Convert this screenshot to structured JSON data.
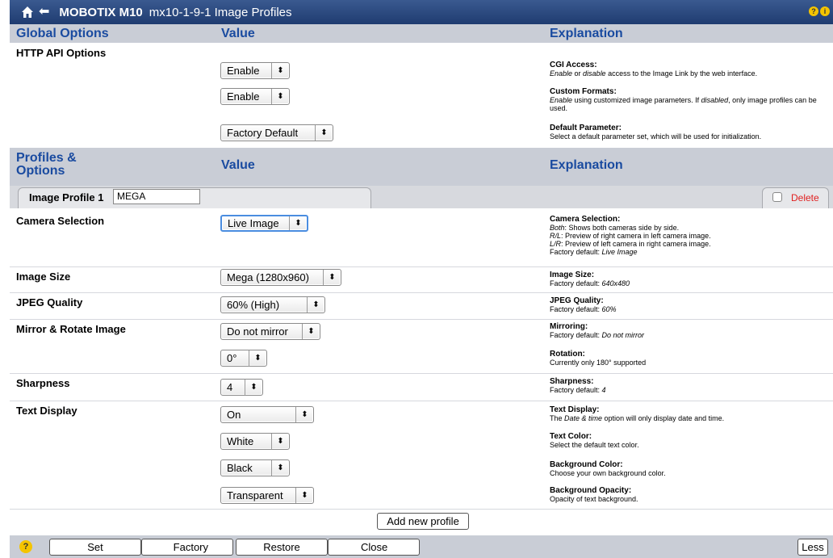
{
  "header": {
    "brand": "MOBOTIX M10",
    "subtitle": "mx10-1-9-1 Image Profiles"
  },
  "global": {
    "heading": "Global Options",
    "value_heading": "Value",
    "explanation_heading": "Explanation",
    "rows": [
      {
        "label": "HTTP API Options"
      }
    ],
    "selects": [
      "Enable",
      "Enable",
      "Factory Default"
    ],
    "explanations": [
      {
        "title": "CGI Access",
        "text_a": "Enable",
        "text_b": " or ",
        "text_c": "disable",
        "text_d": " access to the Image Link by the web interface."
      },
      {
        "title": "Custom Formats",
        "text_a": "Enable",
        "text_b": " using customized image parameters. If ",
        "text_c": "disabled",
        "text_d": ", only image profiles can be used."
      },
      {
        "title": "Default Parameter",
        "text_a": "",
        "text_b": "Select a default parameter set, which will be used for initialization.",
        "text_c": "",
        "text_d": ""
      }
    ]
  },
  "profiles": {
    "heading": "Profiles & Options",
    "value_heading": "Value",
    "explanation_heading": "Explanation",
    "tab_label": "Image Profile 1",
    "profile_name": "MEGA",
    "delete_label": "Delete",
    "rows": {
      "camera_selection": "Camera Selection",
      "image_size": "Image Size",
      "jpeg_quality": "JPEG Quality",
      "mirror_rotate": "Mirror & Rotate Image",
      "sharpness": "Sharpness",
      "text_display": "Text Display"
    },
    "selects": {
      "camera_selection": "Live Image",
      "image_size": "Mega (1280x960)",
      "jpeg_quality": "60% (High)",
      "mirror": "Do not mirror",
      "rotation": "0°",
      "sharpness": "4",
      "text_display": "On",
      "text_color": "White",
      "bg_color": "Black",
      "bg_opacity": "Transparent"
    },
    "explanations": {
      "camera_selection": {
        "title": "Camera Selection",
        "l1a": "Both",
        "l1b": ": Shows both cameras side by side.",
        "l2a": "R/L",
        "l2b": ": Preview of right camera in left camera image.",
        "l3a": "L/R",
        "l3b": ": Preview of left camera in right camera image.",
        "l4a": "Factory default: ",
        "l4b": "Live Image"
      },
      "image_size": {
        "title": "Image Size",
        "a": "Factory default: ",
        "b": "640x480"
      },
      "jpeg_quality": {
        "title": "JPEG Quality",
        "a": "Factory default: ",
        "b": "60%"
      },
      "mirroring": {
        "title": "Mirroring",
        "a": "Factory default: ",
        "b": "Do not mirror"
      },
      "rotation": {
        "title": "Rotation",
        "a": "Currently only 180° supported",
        "b": ""
      },
      "sharpness": {
        "title": "Sharpness",
        "a": "Factory default: ",
        "b": "4"
      },
      "text_display": {
        "title": "Text Display",
        "a": "The ",
        "b": "Date & time",
        "c": " option will only display date and time."
      },
      "text_color": {
        "title": "Text Color",
        "a": "Select the default text color."
      },
      "bg_color": {
        "title": "Background Color",
        "a": "Choose your own background color."
      },
      "bg_opacity": {
        "title": "Background Opacity",
        "a": "Opacity of text background."
      }
    },
    "add_button": "Add new profile"
  },
  "footer": {
    "help": "?",
    "set": "Set",
    "factory": "Factory",
    "restore": "Restore",
    "close": "Close",
    "less": "Less"
  }
}
